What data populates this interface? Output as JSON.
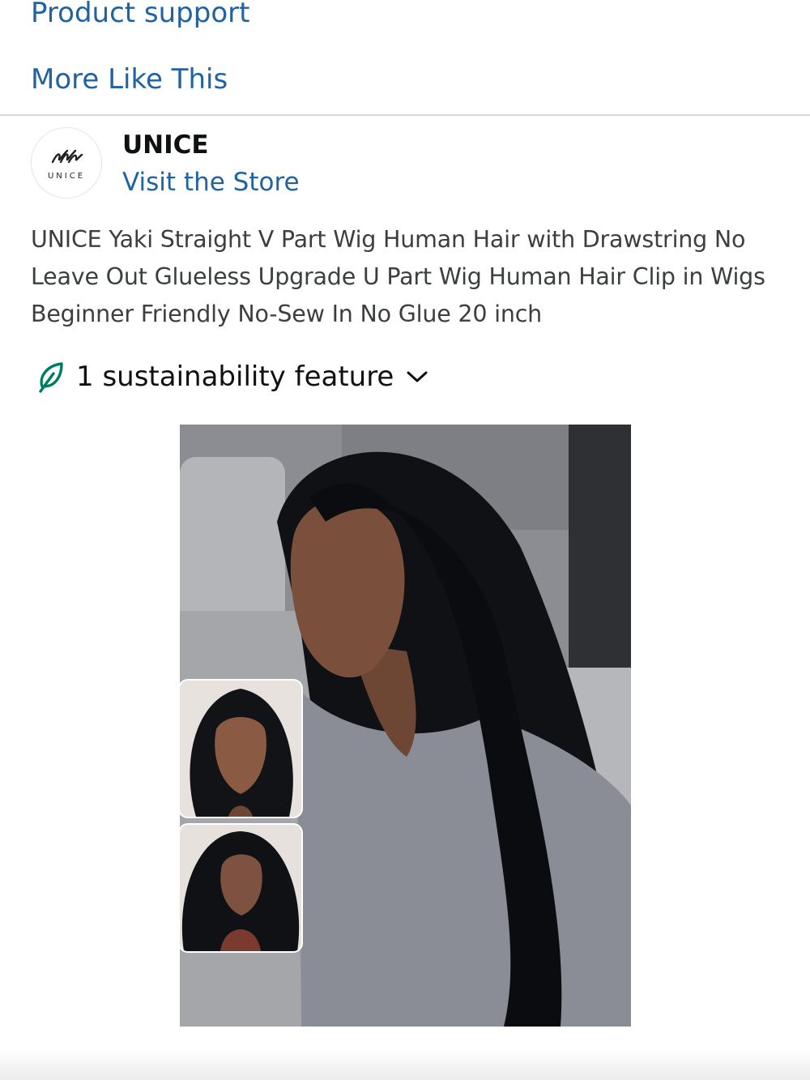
{
  "links": {
    "product_support": "Product support",
    "more_like_this": "More Like This"
  },
  "store": {
    "logo_wordmark": "UNICE",
    "name": "UNICE",
    "visit_label": "Visit the Store"
  },
  "product": {
    "title": "UNICE Yaki Straight V Part Wig Human Hair with Drawstring No Leave Out Glueless Upgrade U Part Wig Human Hair Clip in Wigs Beginner Friendly No-Sew In No Glue 20 inch"
  },
  "sustainability": {
    "label": "1 sustainability feature",
    "icon": "leaf-icon",
    "expand_icon": "chevron-down-icon"
  },
  "colors": {
    "link": "#2162a1",
    "text": "#0f1111",
    "leaf": "#007d60",
    "divider": "#d5d9d9"
  }
}
